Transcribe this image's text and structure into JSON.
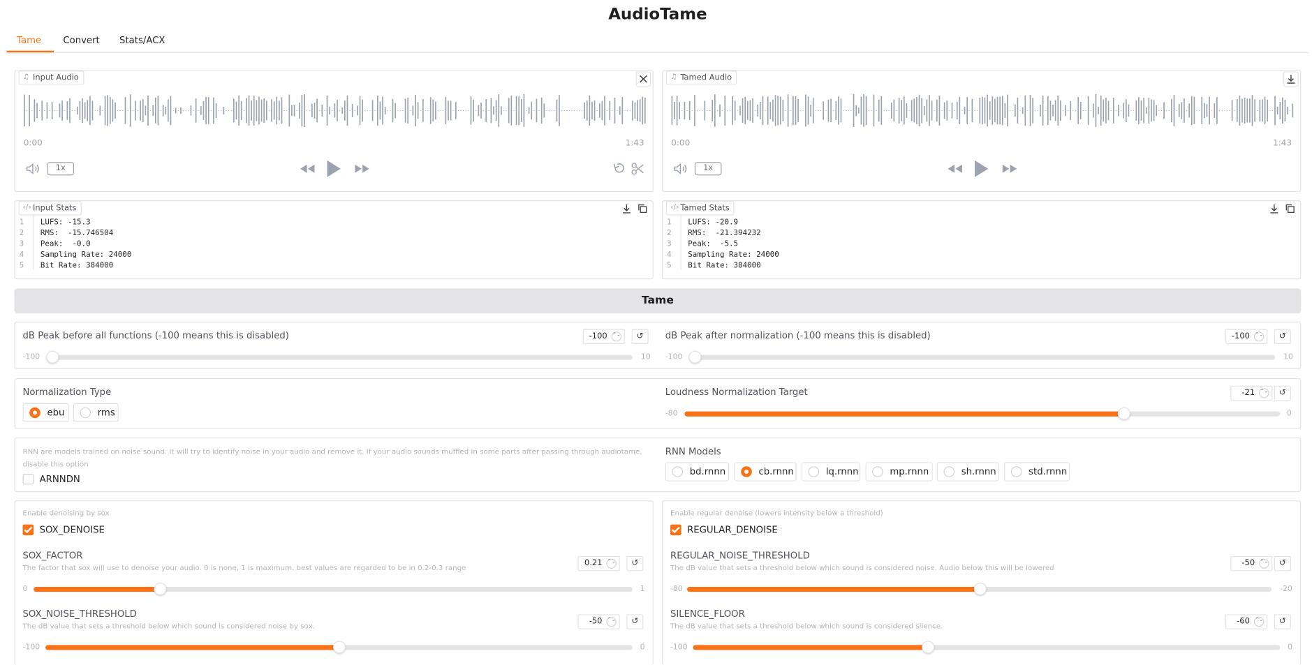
{
  "app": {
    "title": "AudioTame"
  },
  "tabs": [
    {
      "label": "Tame"
    },
    {
      "label": "Convert"
    },
    {
      "label": "Stats/ACX"
    }
  ],
  "input_audio": {
    "label": "Input Audio",
    "time_start": "0:00",
    "time_end": "1:43",
    "speed": "1x"
  },
  "tamed_audio": {
    "label": "Tamed Audio",
    "time_start": "0:00",
    "time_end": "1:43",
    "speed": "1x"
  },
  "input_stats": {
    "label": "Input Stats",
    "lines": [
      "LUFS: -15.3",
      "RMS:  -15.746504",
      "Peak:  -0.0",
      "Sampling Rate: 24000",
      "Bit Rate: 384000"
    ],
    "line_numbers": [
      "1",
      "2",
      "3",
      "4",
      "5"
    ]
  },
  "tamed_stats": {
    "label": "Tamed Stats",
    "lines": [
      "LUFS: -20.9",
      "RMS:  -21.394232",
      "Peak:  -5.5",
      "Sampling Rate: 24000",
      "Bit Rate: 384000"
    ],
    "line_numbers": [
      "1",
      "2",
      "3",
      "4",
      "5"
    ]
  },
  "tame_button": {
    "label": "Tame"
  },
  "peak_before": {
    "label": "dB Peak before all functions (-100 means this is disabled)",
    "value": "-100",
    "min": "-100",
    "max": "10",
    "level": -100
  },
  "peak_after": {
    "label": "dB Peak after normalization (-100 means this is disabled)",
    "value": "-100",
    "min": "-100",
    "max": "10",
    "level": -100
  },
  "normalization_type": {
    "label": "Normalization Type",
    "options": [
      "ebu",
      "rms"
    ],
    "selected": "ebu"
  },
  "loudness_target": {
    "label": "Loudness Normalization Target",
    "value": "-21",
    "min": "-80",
    "max": "0",
    "level": -21
  },
  "rnn": {
    "hint": "RNN are models trained on noise sound. It will try to identify noise in your audio and remove it. If your audio sounds muffled in some parts after passing through audiotame, disable this option",
    "checkbox_label": "ARNNDN",
    "checked": false
  },
  "rnn_models": {
    "label": "RNN Models",
    "options": [
      "bd.rnnn",
      "cb.rnnn",
      "lq.rnnn",
      "mp.rnnn",
      "sh.rnnn",
      "std.rnnn"
    ],
    "selected": "cb.rnnn"
  },
  "sox": {
    "hint": "Enable denoising by sox",
    "checkbox_label": "SOX_DENOISE",
    "checked": true,
    "factor": {
      "label": "SOX_FACTOR",
      "hint": "The factor that sox will use to denoise your audio. 0 is none, 1 is maximum. best values are regarded to be in 0.2-0.3 range",
      "value": "0.21",
      "min": "0",
      "max": "1",
      "level": 0.21
    },
    "threshold": {
      "label": "SOX_NOISE_THRESHOLD",
      "hint": "The dB value that sets a threshold below which sound is considered noise by sox.",
      "value": "-50",
      "min": "-100",
      "max": "0",
      "level": -50
    }
  },
  "regular": {
    "hint": "Enable regular denoise (lowers intensity below a threshold)",
    "checkbox_label": "REGULAR_DENOISE",
    "checked": true,
    "threshold": {
      "label": "REGULAR_NOISE_THRESHOLD",
      "hint": "The dB value that sets a threshold below which sound is considered noise. Audio below this will be lowered",
      "value": "-50",
      "min": "-80",
      "max": "-20",
      "level": -50
    },
    "silence": {
      "label": "SILENCE_FLOOR",
      "hint": "The dB value that sets a threshold below which sound is considered silence.",
      "value": "-60",
      "min": "-100",
      "max": "0",
      "level": -60
    }
  },
  "colors": {
    "accent": "#f97316",
    "border": "#e4e4e7",
    "waveform": "#9ca3af"
  }
}
